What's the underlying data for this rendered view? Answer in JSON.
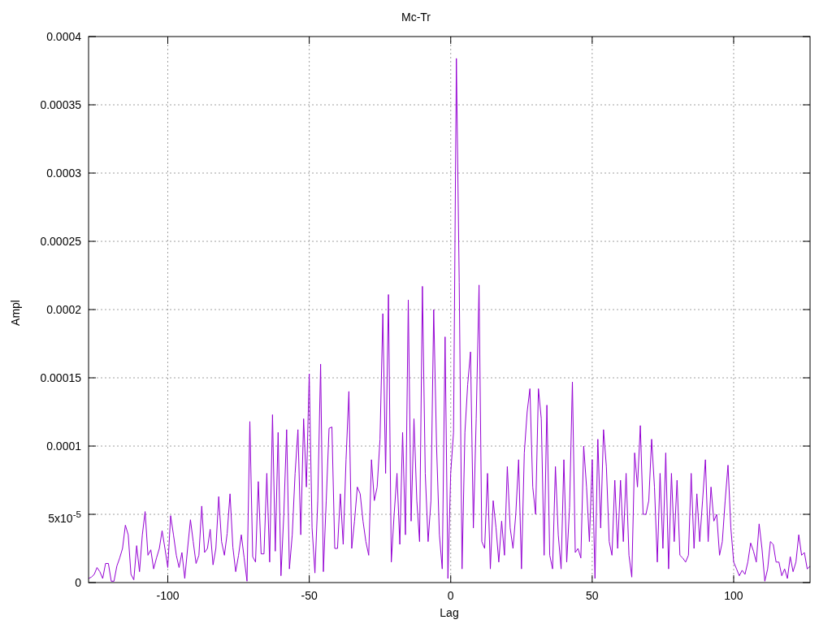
{
  "chart_data": {
    "type": "line",
    "grid": true,
    "title": "Mc-Tr",
    "xlabel": "Lag",
    "ylabel": "Ampl",
    "xlim": [
      -128,
      127
    ],
    "ylim": [
      0,
      0.0004
    ],
    "xticks": [
      -100,
      -50,
      0,
      50,
      100
    ],
    "yticks": [
      0,
      {
        "value": 5e-05,
        "label": "5x10$^{-5}$"
      },
      0.0001,
      0.00015,
      0.0002,
      0.00025,
      0.0003,
      0.00035,
      0.0004
    ],
    "x": [
      -128,
      -127,
      -126,
      -125,
      -124,
      -123,
      -122,
      -121,
      -120,
      -119,
      -118,
      -117,
      -116,
      -115,
      -114,
      -113,
      -112,
      -111,
      -110,
      -109,
      -108,
      -107,
      -106,
      -105,
      -104,
      -103,
      -102,
      -101,
      -100,
      -99,
      -98,
      -97,
      -96,
      -95,
      -94,
      -93,
      -92,
      -91,
      -90,
      -89,
      -88,
      -87,
      -86,
      -85,
      -84,
      -83,
      -82,
      -81,
      -80,
      -79,
      -78,
      -77,
      -76,
      -75,
      -74,
      -73,
      -72,
      -71,
      -70,
      -69,
      -68,
      -67,
      -66,
      -65,
      -64,
      -63,
      -62,
      -61,
      -60,
      -59,
      -58,
      -57,
      -56,
      -55,
      -54,
      -53,
      -52,
      -51,
      -50,
      -49,
      -48,
      -47,
      -46,
      -45,
      -44,
      -43,
      -42,
      -41,
      -40,
      -39,
      -38,
      -37,
      -36,
      -35,
      -34,
      -33,
      -32,
      -31,
      -30,
      -29,
      -28,
      -27,
      -26,
      -25,
      -24,
      -23,
      -22,
      -21,
      -20,
      -19,
      -18,
      -17,
      -16,
      -15,
      -14,
      -13,
      -12,
      -11,
      -10,
      -9,
      -8,
      -7,
      -6,
      -5,
      -4,
      -3,
      -2,
      -1,
      0,
      1,
      2,
      3,
      4,
      5,
      6,
      7,
      8,
      9,
      10,
      11,
      12,
      13,
      14,
      15,
      16,
      17,
      18,
      19,
      20,
      21,
      22,
      23,
      24,
      25,
      26,
      27,
      28,
      29,
      30,
      31,
      32,
      33,
      34,
      35,
      36,
      37,
      38,
      39,
      40,
      41,
      42,
      43,
      44,
      45,
      46,
      47,
      48,
      49,
      50,
      51,
      52,
      53,
      54,
      55,
      56,
      57,
      58,
      59,
      60,
      61,
      62,
      63,
      64,
      65,
      66,
      67,
      68,
      69,
      70,
      71,
      72,
      73,
      74,
      75,
      76,
      77,
      78,
      79,
      80,
      81,
      82,
      83,
      84,
      85,
      86,
      87,
      88,
      89,
      90,
      91,
      92,
      93,
      94,
      95,
      96,
      97,
      98,
      99,
      100,
      101,
      102,
      103,
      104,
      105,
      106,
      107,
      108,
      109,
      110,
      111,
      112,
      113,
      114,
      115,
      116,
      117,
      118,
      119,
      120,
      121,
      122,
      123,
      124,
      125,
      126,
      127
    ],
    "series": [
      {
        "color": "#9400d3",
        "values": [
          3e-06,
          4e-06,
          6e-06,
          1.1e-05,
          8e-06,
          3e-06,
          1.4e-05,
          1.4e-05,
          1e-06,
          1e-06,
          1.2e-05,
          1.8e-05,
          2.5e-05,
          4.2e-05,
          3.5e-05,
          6e-06,
          2e-06,
          2.7e-05,
          8e-06,
          3.5e-05,
          5.2e-05,
          2e-05,
          2.4e-05,
          1e-05,
          1.8e-05,
          2.5e-05,
          3.8e-05,
          2.5e-05,
          1.1e-05,
          4.9e-05,
          3.5e-05,
          2e-05,
          1.1e-05,
          2.2e-05,
          3e-06,
          2.5e-05,
          4.6e-05,
          3e-05,
          1.4e-05,
          2e-05,
          5.6e-05,
          2.2e-05,
          2.5e-05,
          3.9e-05,
          1.3e-05,
          2.5e-05,
          6.3e-05,
          3e-05,
          2e-05,
          3.6e-05,
          6.5e-05,
          2.6e-05,
          8e-06,
          2e-05,
          3.5e-05,
          1.8e-05,
          1e-06,
          0.000118,
          1.9e-05,
          1.5e-05,
          7.4e-05,
          2.1e-05,
          2.1e-05,
          8e-05,
          1.5e-05,
          0.000123,
          2.3e-05,
          0.00011,
          5e-06,
          5e-05,
          0.000112,
          1e-05,
          3.5e-05,
          8e-05,
          0.000112,
          3.5e-05,
          0.00012,
          7e-05,
          0.000153,
          4e-05,
          7e-06,
          6e-05,
          0.00016,
          8e-06,
          6e-05,
          0.000113,
          0.000114,
          2.5e-05,
          2.5e-05,
          6.5e-05,
          2.8e-05,
          9e-05,
          0.00014,
          2.5e-05,
          4.5e-05,
          7e-05,
          6.5e-05,
          4.5e-05,
          3e-05,
          2e-05,
          9e-05,
          6e-05,
          7e-05,
          0.000105,
          0.000197,
          8e-05,
          0.000211,
          1.5e-05,
          5e-05,
          8e-05,
          2.8e-05,
          0.00011,
          3.5e-05,
          0.000207,
          4.5e-05,
          0.00012,
          6e-05,
          3e-05,
          0.000217,
          8e-05,
          3e-05,
          6e-05,
          0.0002,
          0.0001,
          3.5e-05,
          1e-05,
          0.00018,
          3e-06,
          8e-05,
          0.00011,
          0.000384,
          0.00022,
          1e-05,
          0.00011,
          0.000145,
          0.000169,
          4e-05,
          0.00012,
          0.000218,
          3e-05,
          2.5e-05,
          8e-05,
          1e-05,
          6e-05,
          4e-05,
          1.5e-05,
          4.5e-05,
          2e-05,
          8.5e-05,
          4e-05,
          2.5e-05,
          5e-05,
          9e-05,
          1e-05,
          9.5e-05,
          0.000125,
          0.000142,
          7e-05,
          5e-05,
          0.000142,
          0.00012,
          2e-05,
          0.00013,
          2e-05,
          1e-05,
          8.5e-05,
          3.5e-05,
          1e-05,
          9e-05,
          1.5e-05,
          5.5e-05,
          0.000147,
          2.2e-05,
          2.5e-05,
          1.8e-05,
          0.0001,
          7e-05,
          3e-05,
          9e-05,
          3e-06,
          0.000105,
          4e-05,
          0.000112,
          8.5e-05,
          3e-05,
          2e-05,
          7.5e-05,
          2.5e-05,
          7.5e-05,
          3e-05,
          8e-05,
          2e-05,
          4e-06,
          9.5e-05,
          7e-05,
          0.000115,
          5e-05,
          5e-05,
          6e-05,
          0.000105,
          7e-05,
          1.5e-05,
          8e-05,
          2.5e-05,
          9.5e-05,
          1e-05,
          8e-05,
          3e-05,
          7.5e-05,
          2e-05,
          1.8e-05,
          1.5e-05,
          2e-05,
          8e-05,
          2.5e-05,
          6.5e-05,
          3e-05,
          6e-05,
          9e-05,
          3e-05,
          7e-05,
          4.5e-05,
          5e-05,
          2e-05,
          3e-05,
          6e-05,
          8.6e-05,
          4e-05,
          1.5e-05,
          1e-05,
          5e-06,
          9e-06,
          6e-06,
          1.5e-05,
          2.9e-05,
          2.3e-05,
          1.5e-05,
          4.3e-05,
          2.5e-05,
          1e-06,
          1e-05,
          3e-05,
          2.8e-05,
          1.5e-05,
          1.5e-05,
          5e-06,
          1e-05,
          3e-06,
          1.9e-05,
          8e-06,
          1.5e-05,
          3.5e-05,
          2e-05,
          2.2e-05,
          1e-05,
          1.2e-05
        ]
      }
    ]
  }
}
